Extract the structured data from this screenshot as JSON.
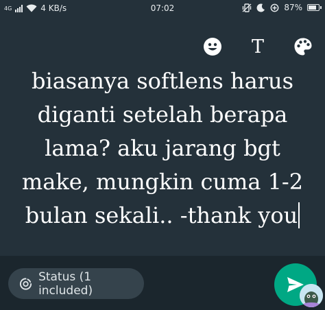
{
  "status_bar": {
    "network_type": "4G",
    "data_speed": "4 KB/s",
    "time": "07:02",
    "battery_percent": "87%",
    "battery_level": 0.87,
    "icons": [
      "signal-icon",
      "wifi-icon",
      "vibrate-icon",
      "moon-icon",
      "data-saver-icon",
      "battery-icon"
    ]
  },
  "editor": {
    "tools": [
      "emoji-icon",
      "text-icon",
      "palette-icon"
    ],
    "text_tool_glyph": "T",
    "caption": "biasanya softlens harus diganti setelah berapa lama? aku jarang bgt make, mungkin cuma 1-2 bulan sekali.. -thank you"
  },
  "bottom": {
    "status_audience": "Status (1 included)",
    "send_color": "#00a884"
  },
  "colors": {
    "background": "#24313a",
    "bottom_bar": "#1b262d",
    "pill": "#35434c",
    "accent": "#00a884"
  }
}
